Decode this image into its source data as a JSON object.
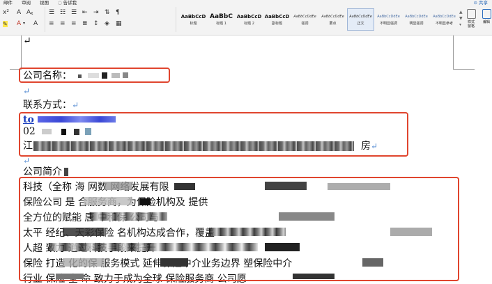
{
  "menu": {
    "items": [
      "邮件",
      "审阅",
      "视图",
      "告诉我"
    ],
    "share": "共享"
  },
  "toolbar": {
    "list_icon": "list-icon",
    "highlight_icon": "highlighter-icon",
    "font_color_icon": "font-color-icon"
  },
  "styles": [
    {
      "preview": "AaBbCcD",
      "label": "标题",
      "kind": "mid"
    },
    {
      "preview": "AaBbC",
      "label": "标题 1",
      "kind": "big"
    },
    {
      "preview": "AaBbCcD",
      "label": "标题 2",
      "kind": "mid"
    },
    {
      "preview": "AaBbCcD",
      "label": "副标题",
      "kind": "mid"
    },
    {
      "preview": "AaBbCcDdEe",
      "label": "强调",
      "kind": "small"
    },
    {
      "preview": "AaBbCcDdEe",
      "label": "要点",
      "kind": "small"
    },
    {
      "preview": "AaBbCcDdEe",
      "label": "正文",
      "kind": "small"
    },
    {
      "preview": "AaBbCcDdEe",
      "label": "不明显强调",
      "kind": "accent"
    },
    {
      "preview": "AaBbCcDdEe",
      "label": "明显强调",
      "kind": "accent"
    },
    {
      "preview": "AaBbCcDdEe",
      "label": "不明显参考",
      "kind": "accent"
    }
  ],
  "panes": {
    "styles_pane": "样式\n窗格",
    "editor": "编辑"
  },
  "doc": {
    "paragraph_mark": "↵",
    "company_label": "公司名称：",
    "contact_label": "联系方式：",
    "contact_email": "to",
    "contact_phone": "02",
    "address_start": "江",
    "address_end": "房",
    "intro_label": "公司简介",
    "intro_lines": [
      "   科技（全称   海     网数   网络发展有限     ",
      "保险公司      是         合服务商，为保险机构及   提供",
      "全方位的赋能              唐 中和保              公司与",
      "太平           经纪、天彩保险           名机构达成合作，覆盖",
      "人超                          致力 通过科技手段来提升",
      "保险       打造  化的保     服务模式  延伸保险中介业务边界  塑保险中介",
      "行业         保险   全  命  致力于成为全球   保险服务商  公司愿"
    ]
  },
  "colors": {
    "highlight_box": "#e0452e",
    "paragraph_mark": "#4e87d0",
    "link": "#1a3fbf"
  }
}
